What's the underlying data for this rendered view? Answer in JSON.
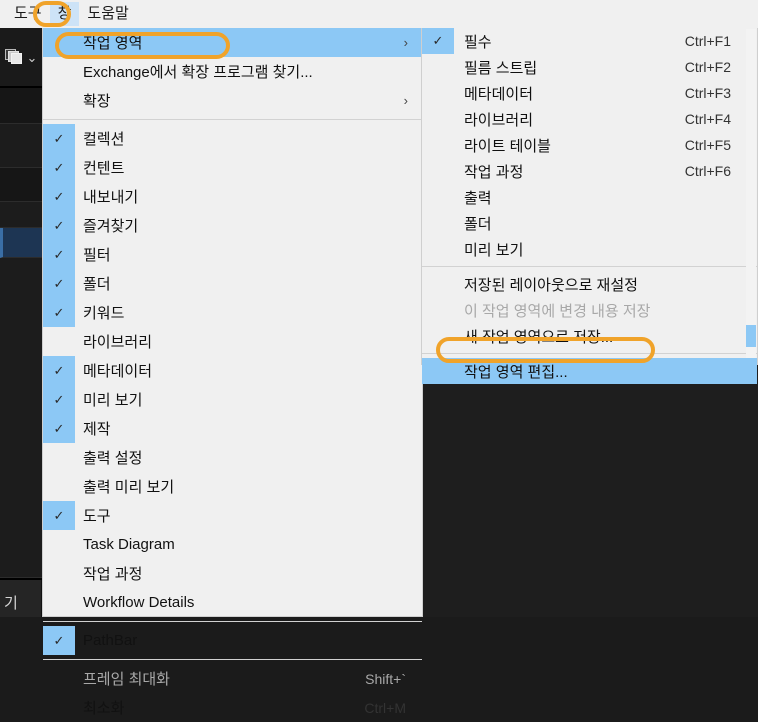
{
  "menubar": {
    "items": [
      {
        "label": "도구",
        "active": false
      },
      {
        "label": "창",
        "active": true
      },
      {
        "label": "도움말",
        "active": false
      }
    ]
  },
  "left_rail": {
    "stack_icon": "stack-panels-icon",
    "chevron_icon": "chevron-down-icon",
    "bottom_label": "기"
  },
  "window_menu": {
    "items": [
      {
        "label": "작업 영역",
        "checked": false,
        "arrow": "›",
        "accel": "",
        "disabled": false,
        "highlight": true
      },
      {
        "label": " Exchange에서 확장 프로그램 찾기...",
        "checked": false,
        "arrow": "",
        "accel": "",
        "disabled": false,
        "highlight": false
      },
      {
        "label": "확장",
        "checked": false,
        "arrow": "›",
        "accel": "",
        "disabled": false,
        "highlight": false
      },
      {
        "label": "컬렉션",
        "checked": true,
        "arrow": "",
        "accel": "",
        "disabled": false,
        "highlight": false
      },
      {
        "label": "컨텐트",
        "checked": true,
        "arrow": "",
        "accel": "",
        "disabled": false,
        "highlight": false
      },
      {
        "label": "내보내기",
        "checked": true,
        "arrow": "",
        "accel": "",
        "disabled": false,
        "highlight": false
      },
      {
        "label": "즐겨찾기",
        "checked": true,
        "arrow": "",
        "accel": "",
        "disabled": false,
        "highlight": false
      },
      {
        "label": "필터",
        "checked": true,
        "arrow": "",
        "accel": "",
        "disabled": false,
        "highlight": false
      },
      {
        "label": "폴더",
        "checked": true,
        "arrow": "",
        "accel": "",
        "disabled": false,
        "highlight": false
      },
      {
        "label": "키워드",
        "checked": true,
        "arrow": "",
        "accel": "",
        "disabled": false,
        "highlight": false
      },
      {
        "label": "라이브러리",
        "checked": false,
        "arrow": "",
        "accel": "",
        "disabled": false,
        "highlight": false
      },
      {
        "label": "메타데이터",
        "checked": true,
        "arrow": "",
        "accel": "",
        "disabled": false,
        "highlight": false
      },
      {
        "label": "미리 보기",
        "checked": true,
        "arrow": "",
        "accel": "",
        "disabled": false,
        "highlight": false
      },
      {
        "label": "제작",
        "checked": true,
        "arrow": "",
        "accel": "",
        "disabled": false,
        "highlight": false
      },
      {
        "label": "출력 설정",
        "checked": false,
        "arrow": "",
        "accel": "",
        "disabled": false,
        "highlight": false
      },
      {
        "label": "출력 미리 보기",
        "checked": false,
        "arrow": "",
        "accel": "",
        "disabled": false,
        "highlight": false
      },
      {
        "label": "도구",
        "checked": true,
        "arrow": "",
        "accel": "",
        "disabled": false,
        "highlight": false
      },
      {
        "label": "Task Diagram",
        "checked": false,
        "arrow": "",
        "accel": "",
        "disabled": false,
        "highlight": false
      },
      {
        "label": "작업 과정",
        "checked": false,
        "arrow": "",
        "accel": "",
        "disabled": false,
        "highlight": false
      },
      {
        "label": "Workflow Details",
        "checked": false,
        "arrow": "",
        "accel": "",
        "disabled": false,
        "highlight": false
      },
      {
        "label": "PathBar",
        "checked": true,
        "arrow": "",
        "accel": "",
        "disabled": false,
        "highlight": false
      },
      {
        "label": "프레임 최대화",
        "checked": false,
        "arrow": "",
        "accel": "Shift+`",
        "disabled": true,
        "highlight": false
      },
      {
        "label": "최소화",
        "checked": false,
        "arrow": "",
        "accel": "Ctrl+M",
        "disabled": false,
        "highlight": false
      }
    ],
    "separator_after": [
      2,
      19,
      20
    ]
  },
  "workspace_submenu": {
    "items": [
      {
        "label": "필수",
        "checked": true,
        "accel": "Ctrl+F1",
        "disabled": false,
        "highlight": false
      },
      {
        "label": "필름 스트립",
        "checked": false,
        "accel": "Ctrl+F2",
        "disabled": false,
        "highlight": false
      },
      {
        "label": "메타데이터",
        "checked": false,
        "accel": "Ctrl+F3",
        "disabled": false,
        "highlight": false
      },
      {
        "label": "라이브러리",
        "checked": false,
        "accel": "Ctrl+F4",
        "disabled": false,
        "highlight": false
      },
      {
        "label": "라이트 테이블",
        "checked": false,
        "accel": "Ctrl+F5",
        "disabled": false,
        "highlight": false
      },
      {
        "label": "작업 과정",
        "checked": false,
        "accel": "Ctrl+F6",
        "disabled": false,
        "highlight": false
      },
      {
        "label": "출력",
        "checked": false,
        "accel": "",
        "disabled": false,
        "highlight": false
      },
      {
        "label": "폴더",
        "checked": false,
        "accel": "",
        "disabled": false,
        "highlight": false
      },
      {
        "label": "미리 보기",
        "checked": false,
        "accel": "",
        "disabled": false,
        "highlight": false
      },
      {
        "label": "저장된 레이아웃으로 재설정",
        "checked": false,
        "accel": "",
        "disabled": false,
        "highlight": false
      },
      {
        "label": "이 작업 영역에 변경 내용 저장",
        "checked": false,
        "accel": "",
        "disabled": true,
        "highlight": false
      },
      {
        "label": "새 작업 영역으로 저장...",
        "checked": false,
        "accel": "",
        "disabled": false,
        "highlight": false
      },
      {
        "label": "작업 영역 편집...",
        "checked": false,
        "accel": "",
        "disabled": false,
        "highlight": true
      }
    ],
    "separator_after": [
      8,
      11
    ],
    "scrollbar": {
      "visible": true
    }
  },
  "annotations": {
    "color": "#f0a32a",
    "targets": [
      "창",
      "작업 영역",
      "작업 영역 편집..."
    ]
  },
  "glyphs": {
    "check": "✓",
    "arrow_right": "›",
    "chevron_down": "⌄"
  }
}
